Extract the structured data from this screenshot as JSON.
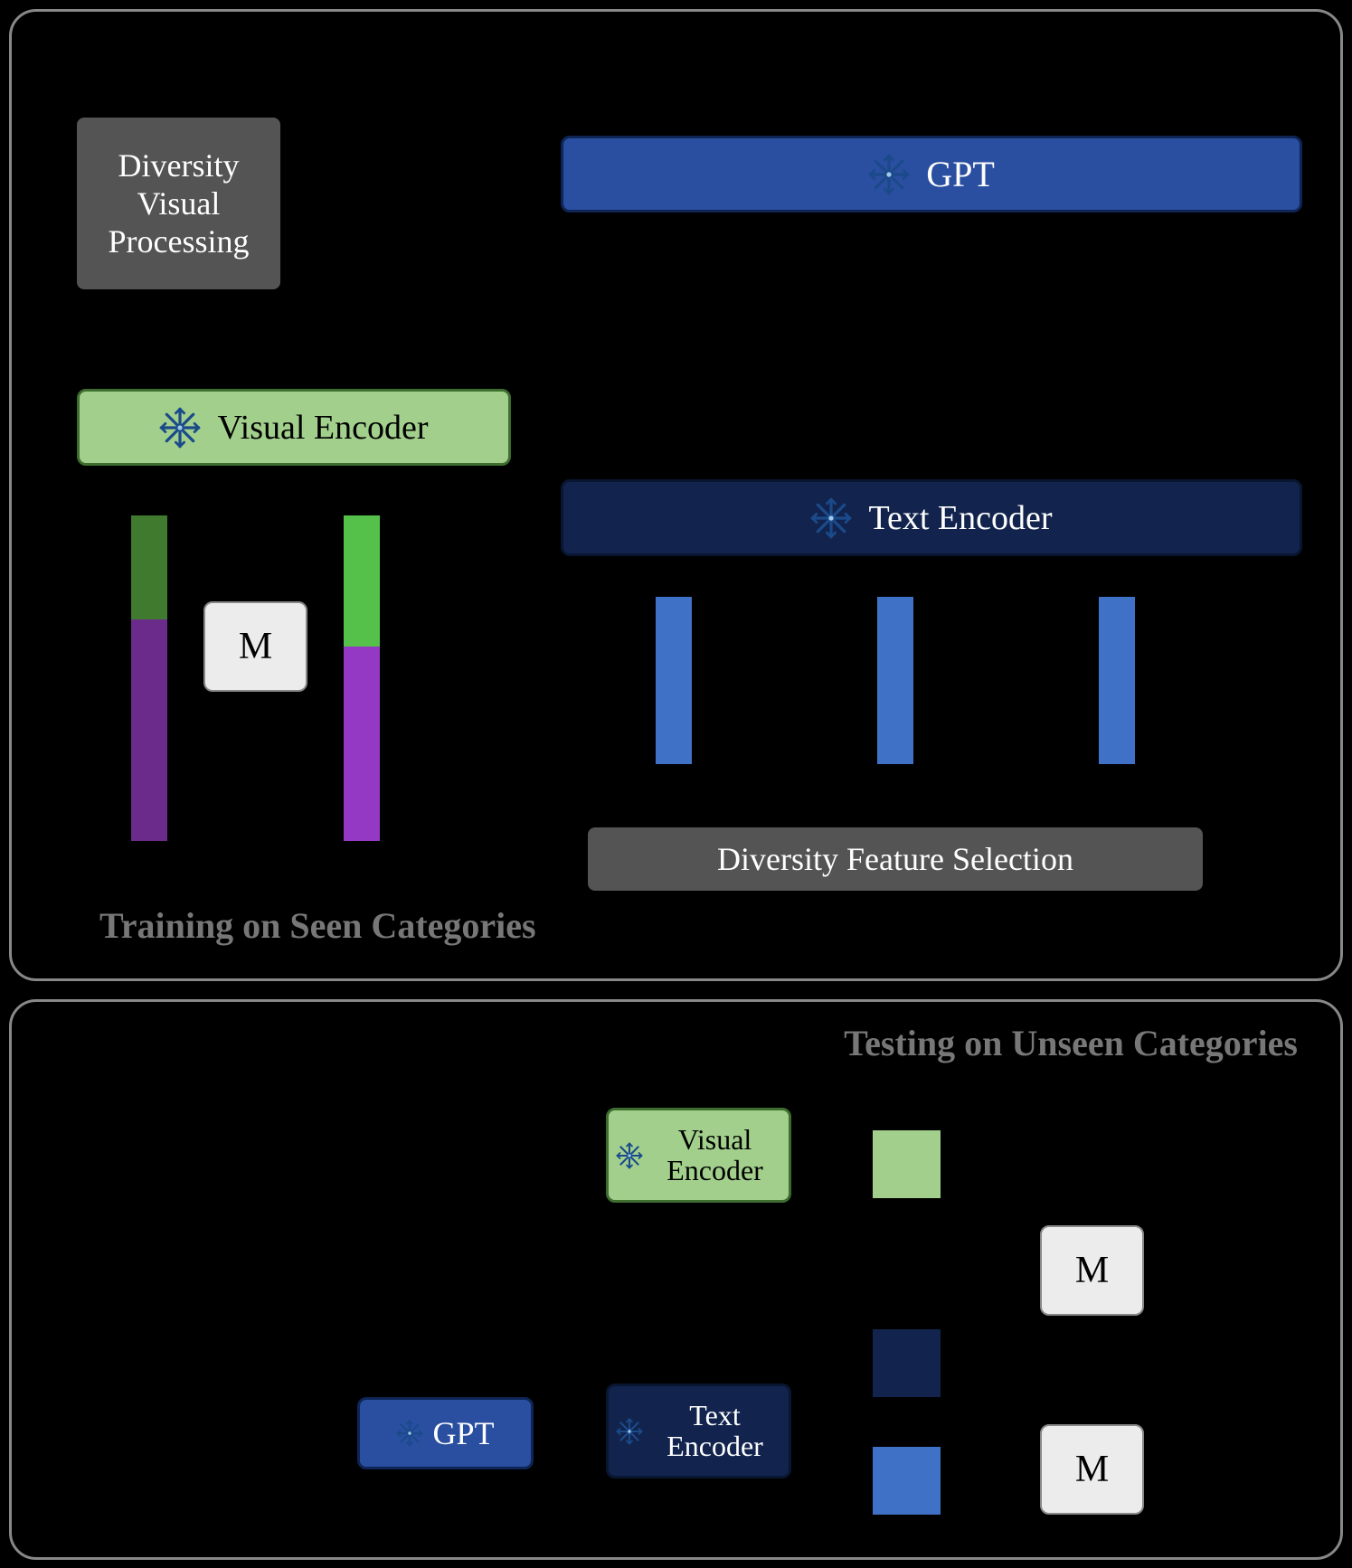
{
  "chart_data": {
    "type": "diagram",
    "top_panel": {
      "title": "Training on Seen Categories",
      "visual_branch": {
        "processing_block": "Diversity Visual Processing",
        "encoder": "Visual Encoder",
        "fusion_module": "M"
      },
      "text_branch": {
        "llm": "GPT",
        "encoder": "Text Encoder",
        "selection_block": "Diversity Feature Selection"
      }
    },
    "bottom_panel": {
      "title": "Testing on Unseen Categories",
      "visual_encoder": "Visual Encoder",
      "text_encoder": "Text Encoder",
      "llm": "GPT",
      "fusion_module_1": "M",
      "fusion_module_2": "M"
    },
    "colors": {
      "gpt_block": "#2a4fa0",
      "text_encoder": "#12244e",
      "visual_encoder": "#a2d08c",
      "grey_block": "#545454",
      "m_block": "#ececec",
      "bar_green_dark": "#3f7a2e",
      "bar_green_light": "#55c14a",
      "bar_purple_dark": "#6b2b8a",
      "bar_purple_light": "#9439c4",
      "bar_blue": "#3f72c6",
      "square_green": "#a2d08c",
      "square_navy": "#12244e",
      "square_blue": "#3f72c6"
    }
  }
}
